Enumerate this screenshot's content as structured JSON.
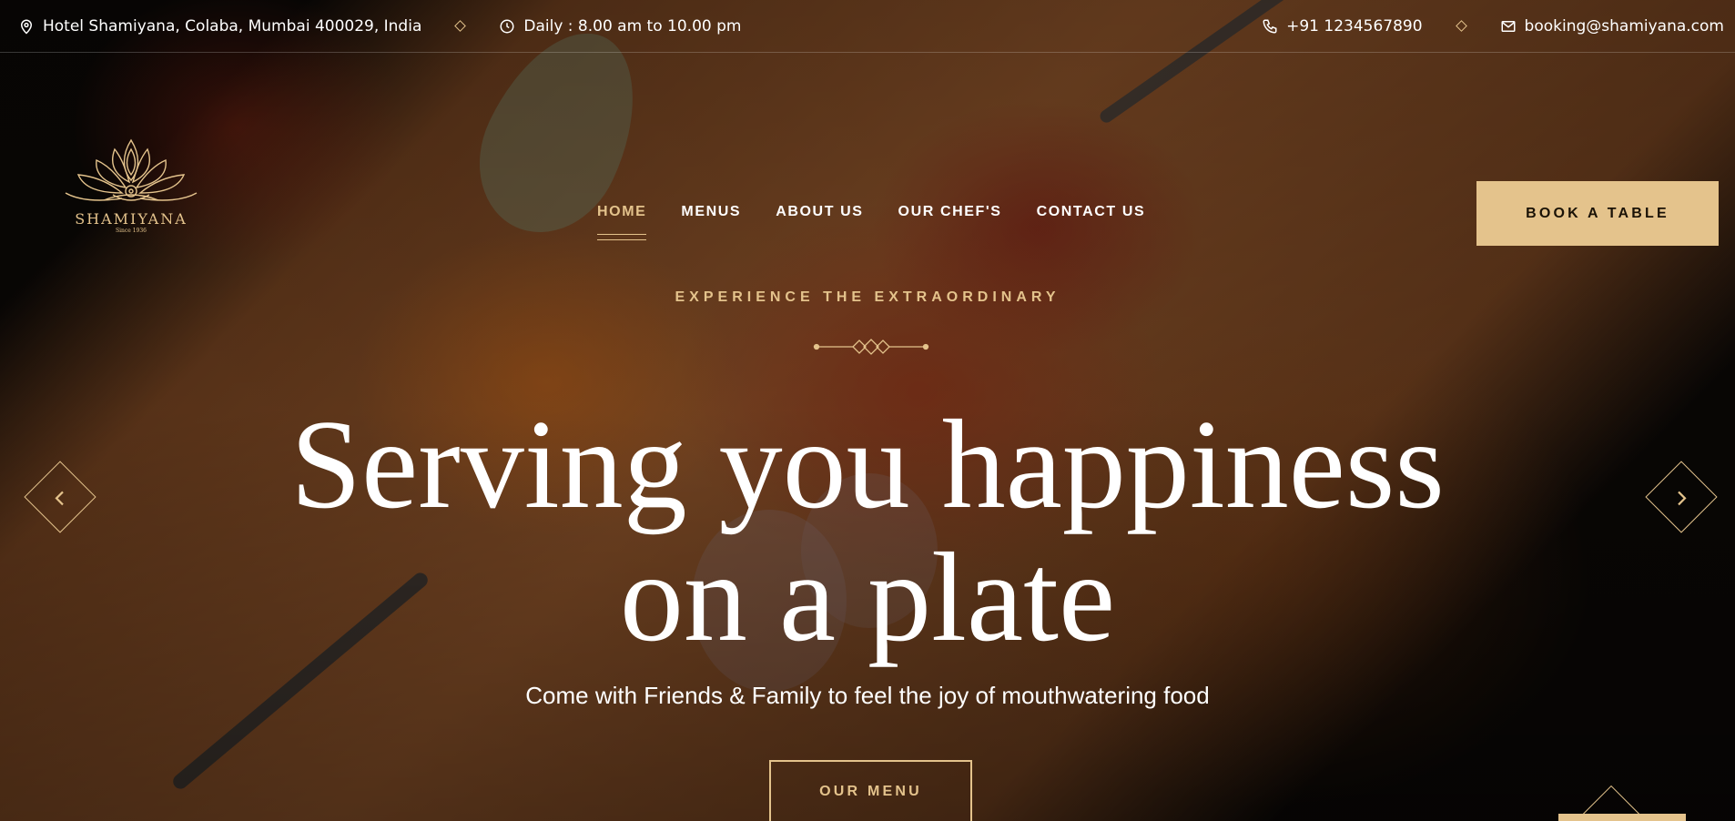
{
  "topbar": {
    "address": "Hotel Shamiyana, Colaba, Mumbai 400029, India",
    "hours": "Daily : 8.00 am to 10.00 pm",
    "phone": "+91 1234567890",
    "email": "booking@shamiyana.com"
  },
  "logo": {
    "name": "SHAMIYANA",
    "since": "Since 1936"
  },
  "nav": {
    "items": [
      {
        "label": "HOME",
        "active": true
      },
      {
        "label": "MENUS"
      },
      {
        "label": "ABOUT US"
      },
      {
        "label": "OUR CHEF'S"
      },
      {
        "label": "CONTACT US"
      }
    ]
  },
  "header": {
    "book_label": "BOOK A TABLE"
  },
  "hero": {
    "eyebrow": "EXPERIENCE THE EXTRAORDINARY",
    "headline_line1": "Serving you happiness",
    "headline_line2": "on a plate",
    "subline": "Come with Friends & Family to feel the joy of mouthwatering food",
    "menu_button": "OUR MENU"
  },
  "icons": {
    "address": "map-pin-icon",
    "hours": "clock-icon",
    "phone": "phone-icon",
    "email": "mail-icon",
    "prev": "chevron-left-icon",
    "next": "chevron-right-icon"
  },
  "colors": {
    "accent": "#e4c38c",
    "text": "#ffffff",
    "background": "#0b0806"
  }
}
